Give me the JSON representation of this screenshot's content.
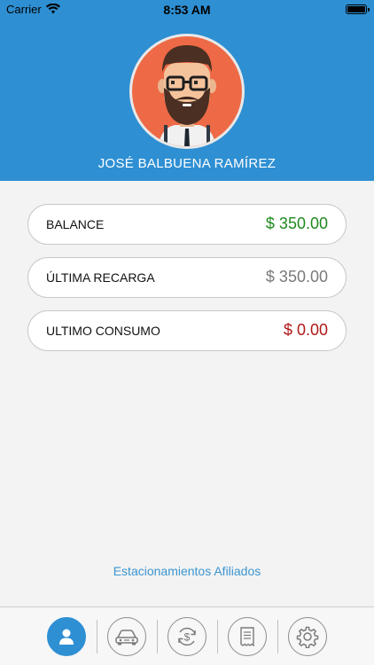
{
  "status_bar": {
    "carrier": "Carrier",
    "time": "8:53 AM"
  },
  "profile": {
    "name": "JOSÉ BALBUENA RAMÍREZ"
  },
  "cards": [
    {
      "label": "BALANCE",
      "value": "$ 350.00",
      "color": "#1e8a1e"
    },
    {
      "label": "ÚLTIMA RECARGA",
      "value": "$ 350.00",
      "color": "#7a7a7a"
    },
    {
      "label": "ULTIMO CONSUMO",
      "value": "$ 0.00",
      "color": "#b01818"
    }
  ],
  "link": {
    "label": "Estacionamientos Afiliados"
  },
  "tabs": [
    {
      "icon": "user-icon",
      "active": true
    },
    {
      "icon": "car-icon",
      "active": false
    },
    {
      "icon": "dollar-refresh-icon",
      "active": false
    },
    {
      "icon": "receipt-icon",
      "active": false
    },
    {
      "icon": "gear-icon",
      "active": false
    }
  ],
  "colors": {
    "accent": "#2e8fd3",
    "background": "#f3f3f3",
    "avatar_bg": "#ee6a46"
  }
}
